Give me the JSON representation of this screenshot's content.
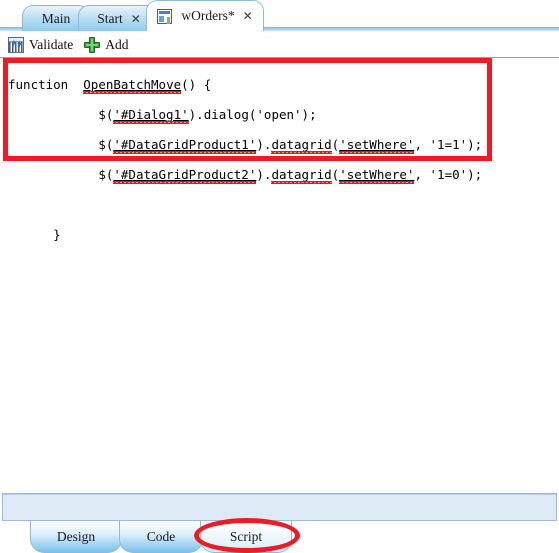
{
  "window": {
    "top_tabs": [
      {
        "label": "Main",
        "closable": false,
        "active": false,
        "icon": ""
      },
      {
        "label": "Start",
        "closable": true,
        "active": false,
        "icon": ""
      },
      {
        "label": "wOrders*",
        "closable": true,
        "active": true,
        "icon": "form-icon"
      }
    ],
    "close_glyph": "✕"
  },
  "toolbar": {
    "validate_label": "Validate",
    "validate_icon": "validate-grid-icon",
    "add_label": "Add",
    "add_icon": "green-plus-icon"
  },
  "editor": {
    "language": "javascript",
    "lines": [
      {
        "indent": 0,
        "text": "function  OpenBatchMove() {"
      },
      {
        "indent": 0,
        "text": "            $('#Dialog1').dialog('open');"
      },
      {
        "indent": 0,
        "text": "            $('#DataGridProduct1').datagrid('setWhere', '1=1');"
      },
      {
        "indent": 0,
        "text": "            $('#DataGridProduct2').datagrid('setWhere', '1=0');"
      },
      {
        "indent": 0,
        "text": ""
      },
      {
        "indent": 0,
        "text": "      }"
      }
    ],
    "tokens": {
      "kw_function": "function",
      "fn_name": "OpenBatchMove",
      "dialog_selector": "'#Dialog1'",
      "dialog_method": "dialog",
      "dialog_arg": "'open'",
      "grid1_selector": "'#DataGridProduct1'",
      "grid2_selector": "'#DataGridProduct2'",
      "grid_method": "datagrid",
      "grid_arg_name": "'setWhere'",
      "grid1_arg_value": "'1=1'",
      "grid2_arg_value": "'1=0'",
      "open_brace": "{",
      "close_brace": "}"
    }
  },
  "bottom_tabs": [
    {
      "label": "Design",
      "active": false
    },
    {
      "label": "Code",
      "active": false
    },
    {
      "label": "Script",
      "active": true
    }
  ],
  "annotations": [
    {
      "type": "rectangle",
      "color": "#ED1C24",
      "target": "code-editor-region"
    },
    {
      "type": "ellipse",
      "color": "#ED1C24",
      "target": "bottom-tab-script"
    }
  ],
  "colors": {
    "annotation_red": "#ED1C24",
    "tab_blue": "#8FCBEE",
    "panel_blue": "#DFEAF7",
    "squiggle_red": "#E01B1B"
  }
}
